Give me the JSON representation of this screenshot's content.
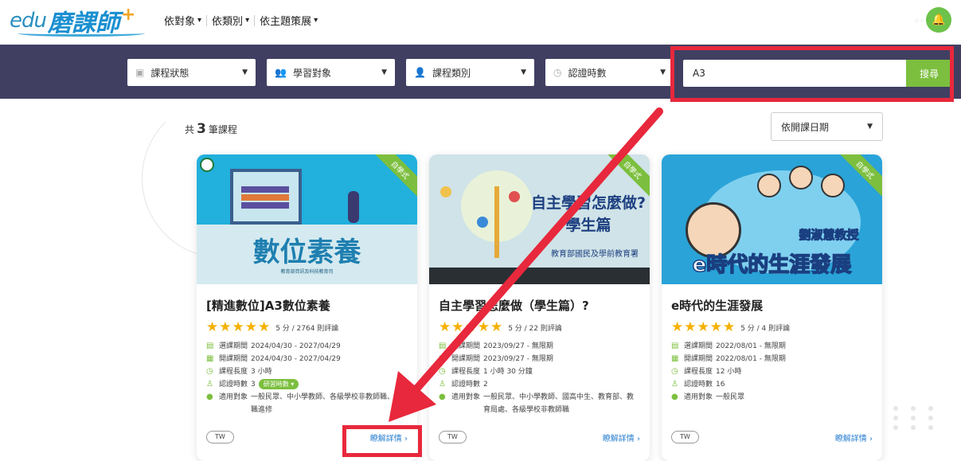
{
  "header": {
    "logo_edu": "edu",
    "logo_main": "磨課師",
    "logo_plus": "+",
    "nav": [
      {
        "label": "依對象"
      },
      {
        "label": "依類別"
      },
      {
        "label": "依主題策展"
      }
    ]
  },
  "filters": {
    "status": "課程狀態",
    "audience": "學習對象",
    "category": "課程類別",
    "hours": "認證時數",
    "search_value": "A3",
    "search_button": "搜尋"
  },
  "results": {
    "prefix": "共",
    "count": "3",
    "suffix": "筆課程",
    "sort": "依開課日期"
  },
  "cards": [
    {
      "ribbon": "自學式",
      "img_title": "數位素養",
      "img_sub": "教育部資訊及科技教育司",
      "title": "[精進數位]A3數位素養",
      "stars": "★★★★★",
      "rating": "5 分 / 2764 則評論",
      "enroll_label": "選課期間",
      "enroll": "2024/04/30 - 2027/04/29",
      "open_label": "開課期間",
      "open": "2024/04/30 - 2027/04/29",
      "length_label": "課程長度",
      "length": "3 小時",
      "hours_label": "認證時數",
      "hours": "3",
      "hours_pill": "研習時數",
      "target_label": "適用對象",
      "target": "一般民眾、中小學教師、各級學校非教師職、在職進修",
      "lang": "TW",
      "detail": "瞭解詳情 ›"
    },
    {
      "ribbon": "自學式",
      "img_title": "自主學習怎麼做?",
      "img_title2": "學生篇",
      "img_sub": "教育部國民及學前教育署",
      "title": "自主學習怎麼做（學生篇）?",
      "stars": "★★★★★",
      "rating": "5 分 / 22 則評論",
      "enroll_label": "選課期間",
      "enroll": "2023/09/27 - 無限期",
      "open_label": "開課期間",
      "open": "2023/09/27 - 無限期",
      "length_label": "課程長度",
      "length": "1 小時 30 分鐘",
      "hours_label": "認證時數",
      "hours": "2",
      "target_label": "適用對象",
      "target": "一般民眾、中小學教師、國高中生、教育部、教育局處、各級學校非教師職",
      "lang": "TW",
      "detail": "瞭解詳情 ›"
    },
    {
      "ribbon": "自學式",
      "img_title": "e時代的生涯發展",
      "img_sub": "劉淑慧教授",
      "title": "e時代的生涯發展",
      "stars": "★★★★★",
      "rating": "5 分 / 4 則評論",
      "enroll_label": "選課期間",
      "enroll": "2022/08/01 - 無限期",
      "open_label": "開課期間",
      "open": "2022/08/01 - 無限期",
      "length_label": "課程長度",
      "length": "12 小時",
      "hours_label": "認證時數",
      "hours": "16",
      "target_label": "適用對象",
      "target": "一般民眾",
      "lang": "TW",
      "detail": "瞭解詳情 ›"
    }
  ],
  "colors": {
    "accent_green": "#7cbf3e",
    "filter_bg": "#403f62",
    "annotation_red": "#e8283c",
    "link_blue": "#2a7fd0"
  }
}
